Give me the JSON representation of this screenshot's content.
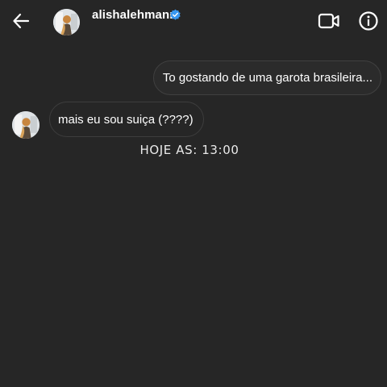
{
  "header": {
    "username": "alishalehmann",
    "verified": true,
    "icons": {
      "back": "arrow-left-icon",
      "verified": "verified-badge-icon",
      "video": "video-camera-icon",
      "info": "info-icon"
    }
  },
  "messages": [
    {
      "direction": "sent",
      "text": "To gostando de uma garota brasileira..."
    },
    {
      "direction": "received",
      "text": "mais eu sou suiça (????)"
    }
  ],
  "timestamp": "HOJE AS: 13:00",
  "colors": {
    "background": "#262626",
    "bubble_border": "#3d3d3d",
    "verified_blue": "#3897f0",
    "text": "#ffffff"
  }
}
